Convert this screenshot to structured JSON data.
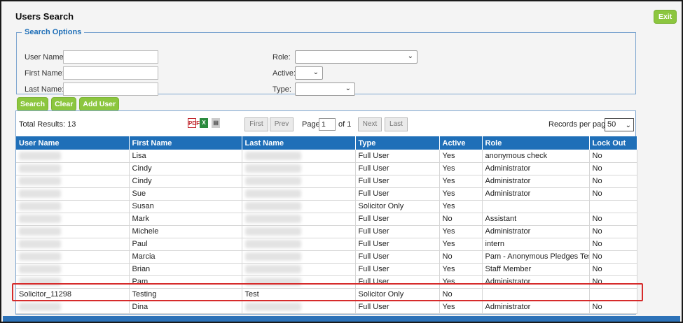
{
  "page": {
    "title": "Users Search",
    "exit_label": "Exit"
  },
  "search_options": {
    "legend": "Search Options",
    "user_name_label": "User Name:",
    "first_name_label": "First Name:",
    "last_name_label": "Last Name:",
    "role_label": "Role:",
    "active_label": "Active:",
    "type_label": "Type:",
    "user_name_value": "",
    "first_name_value": "",
    "last_name_value": "",
    "role_value": "",
    "active_value": "",
    "type_value": ""
  },
  "actions": {
    "search_label": "Search",
    "clear_label": "Clear",
    "add_user_label": "Add User"
  },
  "results": {
    "total_label": "Total Results: 13",
    "export_icons": [
      "pdf-icon",
      "excel-icon",
      "document-icon"
    ],
    "pager": {
      "first": "First",
      "prev": "Prev",
      "page_label": "Page",
      "page_value": "1",
      "of_label": "of 1",
      "next": "Next",
      "last": "Last"
    },
    "records_per_page_label": "Records per page:",
    "records_per_page_value": "50",
    "columns": [
      "User Name",
      "First Name",
      "Last Name",
      "Type",
      "Active",
      "Role",
      "Lock Out"
    ],
    "rows": [
      {
        "user_name": "",
        "first_name": "Lisa",
        "last_name": "",
        "type": "Full User",
        "active": "Yes",
        "role": "anonymous check",
        "lock_out": "No"
      },
      {
        "user_name": "",
        "first_name": "Cindy",
        "last_name": "",
        "type": "Full User",
        "active": "Yes",
        "role": "Administrator",
        "lock_out": "No"
      },
      {
        "user_name": "",
        "first_name": "Cindy",
        "last_name": "",
        "type": "Full User",
        "active": "Yes",
        "role": "Administrator",
        "lock_out": "No"
      },
      {
        "user_name": "",
        "first_name": "Sue",
        "last_name": "",
        "type": "Full User",
        "active": "Yes",
        "role": "Administrator",
        "lock_out": "No"
      },
      {
        "user_name": "",
        "first_name": "Susan",
        "last_name": "",
        "type": "Solicitor Only",
        "active": "Yes",
        "role": "",
        "lock_out": ""
      },
      {
        "user_name": "",
        "first_name": "Mark",
        "last_name": "",
        "type": "Full User",
        "active": "No",
        "role": "Assistant",
        "lock_out": "No"
      },
      {
        "user_name": "",
        "first_name": "Michele",
        "last_name": "",
        "type": "Full User",
        "active": "Yes",
        "role": "Administrator",
        "lock_out": "No"
      },
      {
        "user_name": "",
        "first_name": "Paul",
        "last_name": "",
        "type": "Full User",
        "active": "Yes",
        "role": "intern",
        "lock_out": "No"
      },
      {
        "user_name": "",
        "first_name": "Marcia",
        "last_name": "",
        "type": "Full User",
        "active": "No",
        "role": "Pam - Anonymous Pledges Test",
        "lock_out": "No"
      },
      {
        "user_name": "",
        "first_name": "Brian",
        "last_name": "",
        "type": "Full User",
        "active": "Yes",
        "role": "Staff Member",
        "lock_out": "No"
      },
      {
        "user_name": "",
        "first_name": "Pam",
        "last_name": "",
        "type": "Full User",
        "active": "Yes",
        "role": "Administrator",
        "lock_out": "No"
      },
      {
        "user_name": "Solicitor_11298",
        "first_name": "Testing",
        "last_name": "Test",
        "type": "Solicitor Only",
        "active": "No",
        "role": "",
        "lock_out": ""
      },
      {
        "user_name": "",
        "first_name": "Dina",
        "last_name": "",
        "type": "Full User",
        "active": "Yes",
        "role": "Administrator",
        "lock_out": "No"
      }
    ]
  },
  "colors": {
    "header_blue": "#1f6fb8",
    "button_green": "#8cc63f",
    "highlight_red": "#d62b2b"
  }
}
